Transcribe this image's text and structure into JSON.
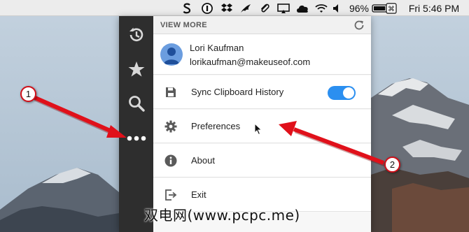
{
  "menubar": {
    "battery_percent": "96%",
    "clock": "Fri 5:46 PM",
    "icons": [
      "scribd-s-icon",
      "1password-icon",
      "dropbox-icon",
      "evernote-icon",
      "clip-icon",
      "airplay-icon",
      "cloud-icon",
      "wifi-icon",
      "volume-icon",
      "battery-icon",
      "keyboard-command-icon"
    ],
    "battery_level": 0.96
  },
  "panel": {
    "rail_icons": [
      "history-icon",
      "star-icon",
      "search-icon",
      "more-icon"
    ],
    "header": {
      "title": "VIEW MORE"
    },
    "account": {
      "name": "Lori Kaufman",
      "email": "lorikaufman@makeuseof.com"
    },
    "items": [
      {
        "label": "Sync Clipboard History",
        "icon": "save-icon",
        "toggle_on": true
      },
      {
        "label": "Preferences",
        "icon": "gear-icon"
      },
      {
        "label": "About",
        "icon": "info-icon"
      },
      {
        "label": "Exit",
        "icon": "exit-icon"
      }
    ]
  },
  "annotations": {
    "callout_1": "1",
    "callout_2": "2"
  },
  "watermark": "双电网(www.pcpc.me)",
  "colors": {
    "rail": "#2e2e2e",
    "toggle_on": "#2b8ff0",
    "arrow": "#e0101a"
  }
}
